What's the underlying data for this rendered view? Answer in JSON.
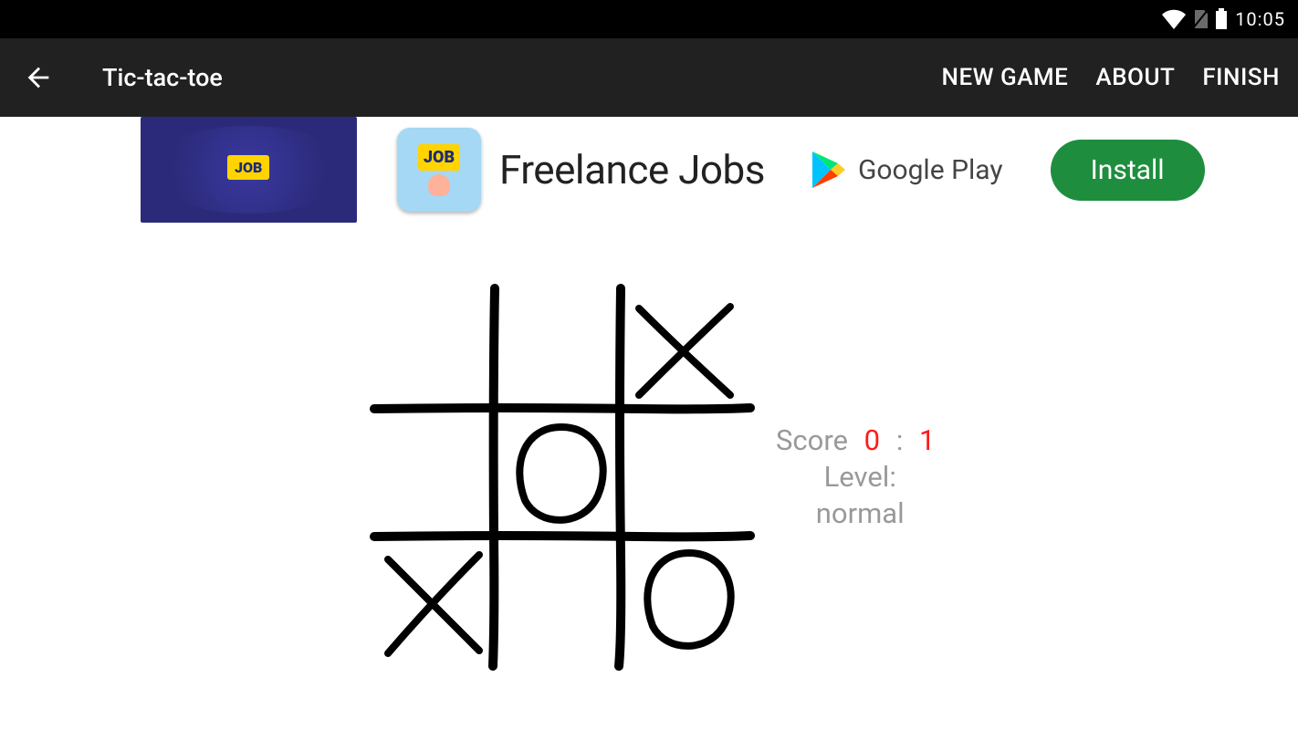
{
  "status_bar": {
    "time": "10:05"
  },
  "app_bar": {
    "title": "Tic-tac-toe",
    "menu": {
      "new_game": "NEW GAME",
      "about": "ABOUT",
      "finish": "FINISH"
    }
  },
  "ad": {
    "badge_small": "JOB",
    "icon_text": "JOB",
    "title": "Freelance Jobs",
    "store": "Google Play",
    "install": "Install"
  },
  "game": {
    "board": [
      [
        "",
        "",
        "X"
      ],
      [
        "",
        "O",
        ""
      ],
      [
        "X",
        "",
        "O"
      ]
    ],
    "score_label": "Score",
    "score_p1": "0",
    "score_sep": ":",
    "score_p2": "1",
    "level_label": "Level:",
    "level_value": "normal"
  }
}
